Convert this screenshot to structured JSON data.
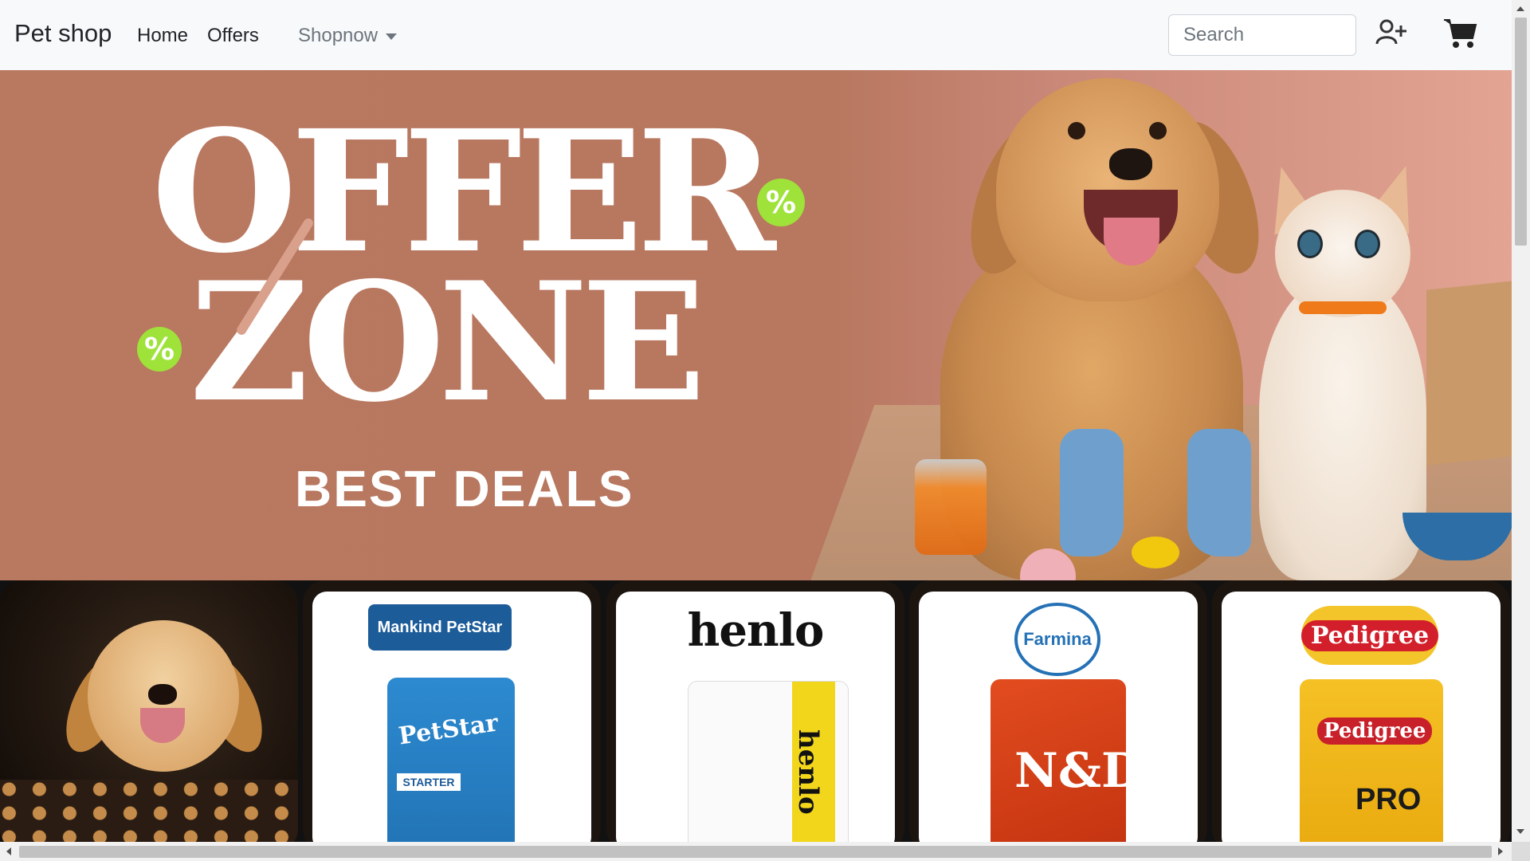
{
  "navbar": {
    "brand": "Pet shop",
    "links": [
      "Home",
      "Offers"
    ],
    "dropdown": "Shopnow",
    "search_placeholder": "Search",
    "icons": [
      "user-plus-icon",
      "cart-icon"
    ]
  },
  "hero": {
    "headline_1": "OFFER",
    "headline_2": "ZONE",
    "subheadline": "BEST DEALS",
    "percent_badge": "%",
    "colors": {
      "background": "#b97860",
      "badge": "#9ee23a",
      "text": "#ffffff"
    }
  },
  "products": [
    {
      "name": "puppy-photo"
    },
    {
      "brand": "Mankind PetStar",
      "pack_label": "PetStar",
      "pack_tag": "STARTER"
    },
    {
      "brand": "henlo",
      "pack_label": "henlo"
    },
    {
      "brand": "Farmina",
      "pack_label": "N&D"
    },
    {
      "brand": "Pedigree",
      "pack_label": "Pedigree",
      "pack_sub": "PRO"
    }
  ]
}
